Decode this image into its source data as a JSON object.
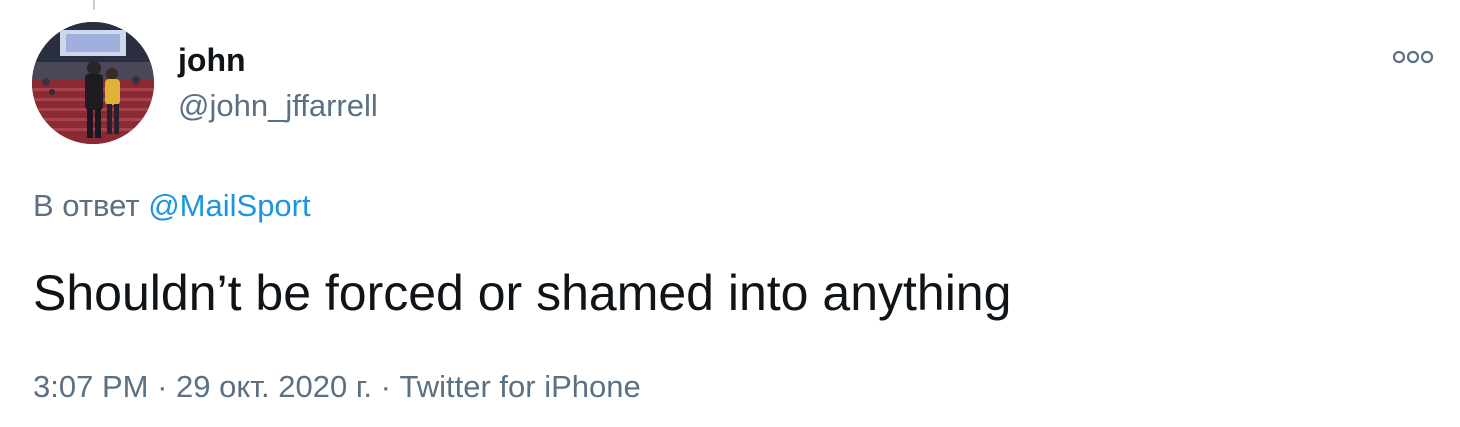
{
  "user": {
    "display_name": "john",
    "handle": "@john_jffarrell",
    "avatar_icon": "user-avatar-photo"
  },
  "menu": {
    "more_icon": "more-options-icon"
  },
  "reply": {
    "prefix": "В ответ",
    "mention": "@MailSport"
  },
  "tweet": {
    "text": "Shouldn’t be forced or shamed into anything"
  },
  "meta": {
    "time": "3:07 PM",
    "separator1": " · ",
    "date": "29 окт. 2020 г.",
    "separator2": " · ",
    "source": "Twitter for iPhone"
  },
  "colors": {
    "text_primary": "#0f1419",
    "text_secondary": "#5b7083",
    "link": "#1b95e0"
  }
}
